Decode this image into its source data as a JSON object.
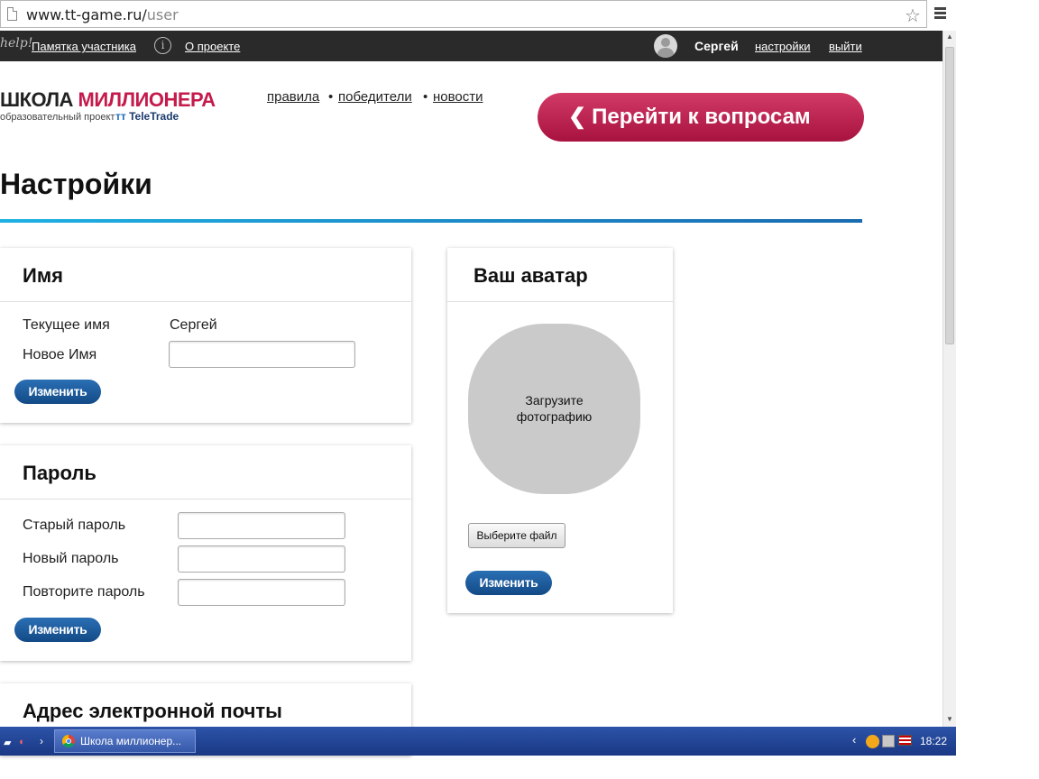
{
  "browser": {
    "url_domain": "www.tt-game.ru/",
    "url_path": "user"
  },
  "topbar": {
    "help_logo": "help!",
    "memo_link": "Памятка участника",
    "about_link": "О проекте",
    "user_name": "Сергей",
    "settings_link": "настройки",
    "logout_link": "выйти"
  },
  "header": {
    "logo_black": "ШКОЛА ",
    "logo_red": "МИЛЛИОНЕРА",
    "logo_subtitle": "образовательный проект",
    "logo_brand": "TeleTrade",
    "nav": [
      {
        "label": "правила"
      },
      {
        "label": "победители"
      },
      {
        "label": "новости"
      }
    ],
    "nav_separator": "•",
    "go_button": "Перейти к вопросам"
  },
  "page_title": "Настройки",
  "name_card": {
    "title": "Имя",
    "current_label": "Текущее имя",
    "current_value": "Сергей",
    "new_label": "Новое Имя",
    "new_value": "",
    "submit": "Изменить"
  },
  "password_card": {
    "title": "Пароль",
    "old_label": "Старый пароль",
    "new_label": "Новый пароль",
    "repeat_label": "Повторите пароль",
    "submit": "Изменить"
  },
  "email_card": {
    "title": "Адрес электронной почты"
  },
  "avatar_card": {
    "title": "Ваш аватар",
    "placeholder_line1": "Загрузите",
    "placeholder_line2": "фотографию",
    "file_button": "Выберите файл",
    "submit": "Изменить"
  },
  "taskbar": {
    "window_title": "Школа миллионер...",
    "clock": "18:22"
  },
  "colors": {
    "accent_red": "#c41b4c",
    "button_blue": "#134a86",
    "topbar_bg": "#2a2a2a",
    "divider_gradient": [
      "#1fb1e3",
      "#1a6bb0"
    ]
  }
}
